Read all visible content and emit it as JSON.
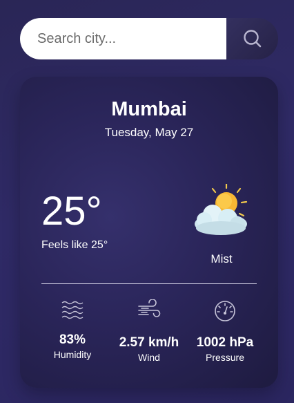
{
  "search": {
    "placeholder": "Search city..."
  },
  "weather": {
    "city": "Mumbai",
    "date": "Tuesday, May 27",
    "temperature": "25°",
    "feels_like": "Feels like 25°",
    "condition": "Mist",
    "condition_icon": "sun-behind-cloud-icon"
  },
  "stats": {
    "humidity": {
      "value": "83%",
      "label": "Humidity",
      "icon": "humidity-waves-icon"
    },
    "wind": {
      "value": "2.57 km/h",
      "label": "Wind",
      "icon": "wind-icon"
    },
    "pressure": {
      "value": "1002 hPa",
      "label": "Pressure",
      "icon": "gauge-icon"
    }
  },
  "colors": {
    "background": "#2b2660",
    "card": "#2a2559",
    "text": "#ffffff",
    "sun": "#f7b733",
    "cloud": "#d8eef5"
  }
}
